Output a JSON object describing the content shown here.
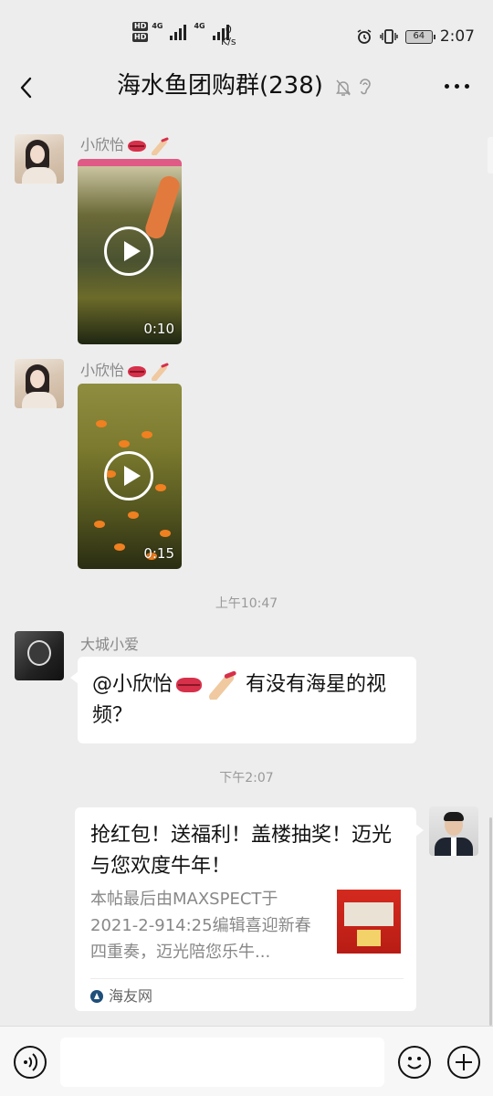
{
  "status_bar": {
    "hd1": "HD",
    "hd2": "HD",
    "net1": "4G",
    "net2": "4G",
    "speed_value": "0",
    "speed_unit": "K/s",
    "battery": "64",
    "time": "2:07"
  },
  "header": {
    "title": "海水鱼团购群(238)"
  },
  "messages": [
    {
      "sender": "小欣怡",
      "type": "video",
      "duration": "0:10"
    },
    {
      "sender": "小欣怡",
      "type": "video",
      "duration": "0:15"
    }
  ],
  "timestamps": [
    "上午10:47",
    "下午2:07"
  ],
  "text_message": {
    "sender": "大城小爱",
    "mention": "@小欣怡",
    "body": "有没有海星的视频？"
  },
  "link_card": {
    "title": "抢红包！送福利！盖楼抽奖！迈光与您欢度牛年！",
    "description": "本帖最后由MAXSPECT于2021-2-914:25编辑喜迎新春四重奏，迈光陪您乐牛...",
    "source": "海友网"
  },
  "input": {
    "placeholder": ""
  },
  "colors": {
    "background": "#ededed",
    "bubble": "#ffffff",
    "timestamp": "#999999"
  }
}
